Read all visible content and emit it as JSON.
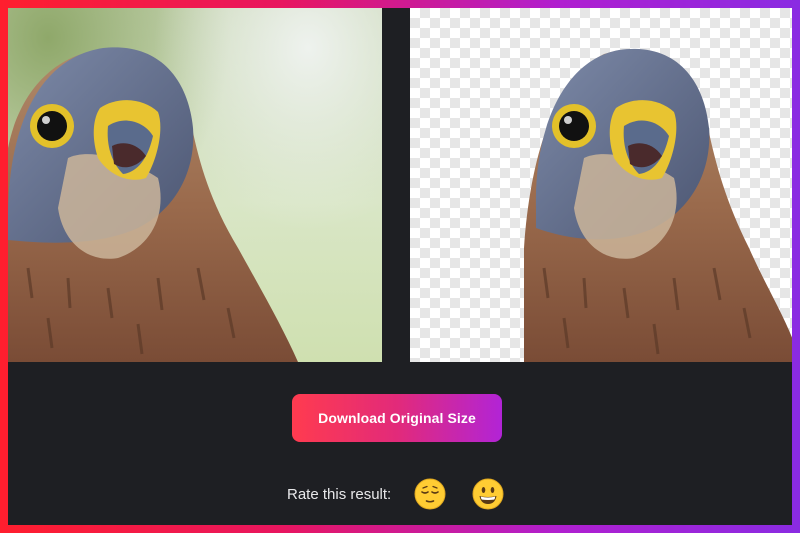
{
  "colors": {
    "frame_gradient_start": "#ff1e2e",
    "frame_gradient_end": "#8a2be2",
    "background": "#1e1f23",
    "button_gradient_start": "#ff3b4f",
    "button_gradient_end": "#b224d6",
    "text": "#e8e8ea"
  },
  "comparison": {
    "original_image": "kestrel-photo-original",
    "result_image": "kestrel-photo-background-removed",
    "result_background": "transparency-checkerboard"
  },
  "actions": {
    "download_label": "Download Original Size"
  },
  "rating": {
    "label": "Rate this result:",
    "options": [
      {
        "icon": "relieved-face-emoji"
      },
      {
        "icon": "grinning-face-emoji"
      }
    ]
  }
}
